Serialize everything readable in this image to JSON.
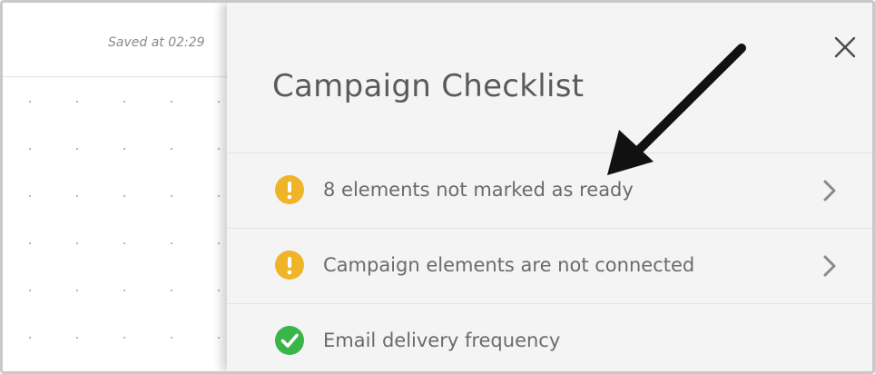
{
  "canvas": {
    "saved_text": "Saved at 02:29"
  },
  "panel": {
    "title": "Campaign Checklist",
    "close_icon": "close-icon",
    "items": [
      {
        "label": "8 elements not marked as ready",
        "status": "warning",
        "icon": "warning-icon",
        "has_chevron": true
      },
      {
        "label": "Campaign elements are not connected",
        "status": "warning",
        "icon": "warning-icon",
        "has_chevron": true
      },
      {
        "label": "Email delivery frequency",
        "status": "ok",
        "icon": "check-circle-icon",
        "has_chevron": false
      }
    ]
  },
  "colors": {
    "warning": "#f0b429",
    "success": "#3ab54a",
    "panel_bg": "#f4f4f4",
    "text": "#6b6b6b"
  },
  "annotation": "arrow-icon"
}
